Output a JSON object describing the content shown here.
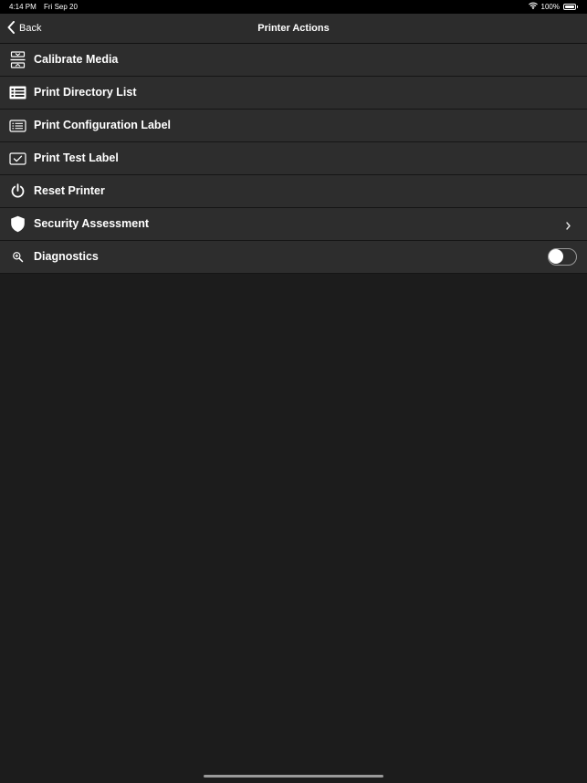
{
  "status_bar": {
    "time": "4:14 PM",
    "date": "Fri Sep 20",
    "battery": "100%",
    "battery_level": 1.0,
    "wifi_icon": "wifi-icon",
    "battery_icon": "battery-icon"
  },
  "nav": {
    "back_label": "Back",
    "back_icon": "chevron-left-icon",
    "title": "Printer Actions"
  },
  "actions": [
    {
      "label": "Calibrate Media",
      "icon": "calibrate-media-icon"
    },
    {
      "label": "Print Directory List",
      "icon": "directory-list-icon"
    },
    {
      "label": "Print Configuration Label",
      "icon": "configuration-label-icon"
    },
    {
      "label": "Print Test Label",
      "icon": "test-label-icon"
    },
    {
      "label": "Reset Printer",
      "icon": "power-icon"
    },
    {
      "label": "Security Assessment",
      "icon": "shield-icon",
      "accessory": "chevron-right-icon"
    },
    {
      "label": "Diagnostics",
      "icon": "zoom-in-icon",
      "accessory": "toggle",
      "toggle_on": false
    }
  ],
  "colors": {
    "background": "#1c1c1c",
    "row_background": "#2d2d2d",
    "nav_background": "#2c2c2c",
    "status_background": "#000000",
    "text": "#ffffff"
  }
}
